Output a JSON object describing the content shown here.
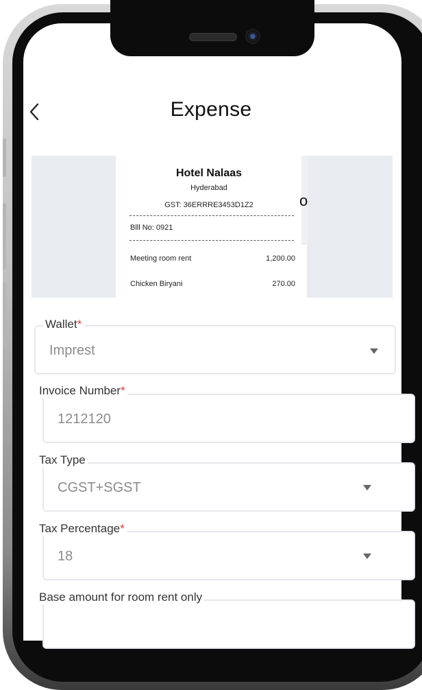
{
  "header": {
    "title": "Expense",
    "back_icon": "chevron-left-icon"
  },
  "receipt": {
    "hotel_name": "Hotel Nalaas",
    "city": "Hyderabad",
    "gst": "GST: 36ERRRE3453D1Z2",
    "bill_no": "Blll No: 0921",
    "items": [
      {
        "name": "Meeting room rent",
        "amount": "1,200.00"
      },
      {
        "name": "Chicken Biryani",
        "amount": "270.00"
      }
    ],
    "peek_char": "o"
  },
  "form": {
    "wallet": {
      "label": "Wallet",
      "required": "*",
      "value": "Imprest"
    },
    "invoice_number": {
      "label": "Invoice Number",
      "required": "*",
      "value": "1212120"
    },
    "tax_type": {
      "label": "Tax Type",
      "value": "CGST+SGST"
    },
    "tax_percentage": {
      "label": "Tax Percentage",
      "required": "*",
      "value": "18"
    },
    "base_amount": {
      "label": "Base amount for room rent only"
    }
  },
  "colors": {
    "required": "#e53935",
    "receipt_bg": "#e8ebef",
    "field_border": "#e6e8ee"
  }
}
